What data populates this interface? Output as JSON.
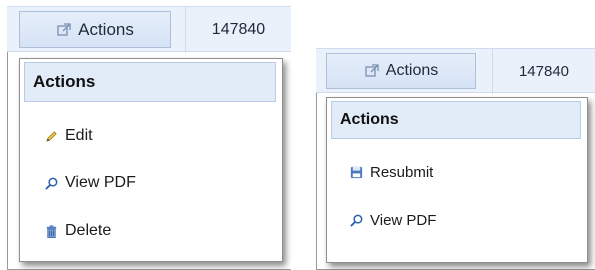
{
  "left_panel": {
    "actions_button_label": "Actions",
    "record_id": "147840",
    "menu": {
      "title": "Actions",
      "items": [
        {
          "label": "Edit",
          "icon": "pencil-icon"
        },
        {
          "label": "View PDF",
          "icon": "magnifier-icon"
        },
        {
          "label": "Delete",
          "icon": "trash-icon"
        }
      ]
    }
  },
  "right_panel": {
    "actions_button_label": "Actions",
    "record_id": "147840",
    "menu": {
      "title": "Actions",
      "items": [
        {
          "label": "Resubmit",
          "icon": "save-icon"
        },
        {
          "label": "View PDF",
          "icon": "magnifier-icon"
        }
      ]
    }
  }
}
